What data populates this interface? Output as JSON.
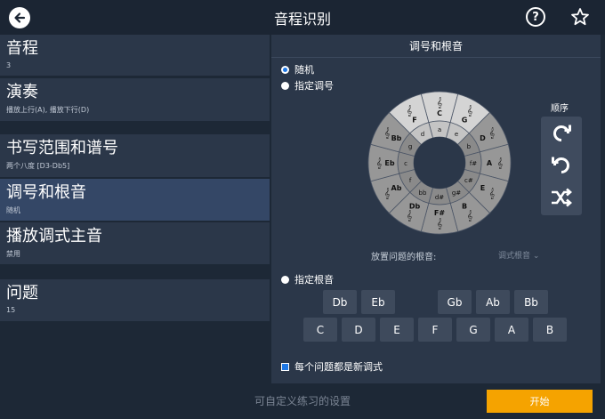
{
  "header": {
    "title": "音程识别"
  },
  "left_panel": {
    "items": [
      {
        "title": "音程",
        "subtitle": "3"
      },
      {
        "title": "演奏",
        "subtitle": "播放上行(A), 播放下行(D)"
      },
      {
        "title": "书写范围和谱号",
        "subtitle": "两个八度 [D3-Db5]"
      },
      {
        "title": "调号和根音",
        "subtitle": "随机"
      },
      {
        "title": "播放调式主音",
        "subtitle": "禁用"
      },
      {
        "title": "问题",
        "subtitle": "15"
      }
    ]
  },
  "right_panel": {
    "title": "调号和根音",
    "options": {
      "random": "随机",
      "specific_key": "指定调号",
      "specific_root": "指定根音"
    },
    "circle": {
      "major_keys": [
        "C",
        "G",
        "D",
        "A",
        "E",
        "B",
        "F#",
        "Db",
        "Ab",
        "Eb",
        "Bb",
        "F"
      ],
      "minor_keys": [
        "a",
        "e",
        "b",
        "f#",
        "c#",
        "g#",
        "d#",
        "bb",
        "f",
        "c",
        "g",
        "d"
      ]
    },
    "order": {
      "label": "顺序"
    },
    "root_question_label": "放置问题的根音:",
    "root_select_value": "调式根音",
    "accidental_roots": [
      "Db",
      "Eb",
      "Gb",
      "Ab",
      "Bb"
    ],
    "natural_roots": [
      "C",
      "D",
      "E",
      "F",
      "G",
      "A",
      "B"
    ],
    "new_key_checkbox": "每个问题都是新调式"
  },
  "footer": {
    "label": "可自定义练习的设置",
    "start": "开始"
  },
  "colors": {
    "accent": "#1e78e6",
    "start_button": "#f5a300",
    "selected_row": "#344766"
  }
}
